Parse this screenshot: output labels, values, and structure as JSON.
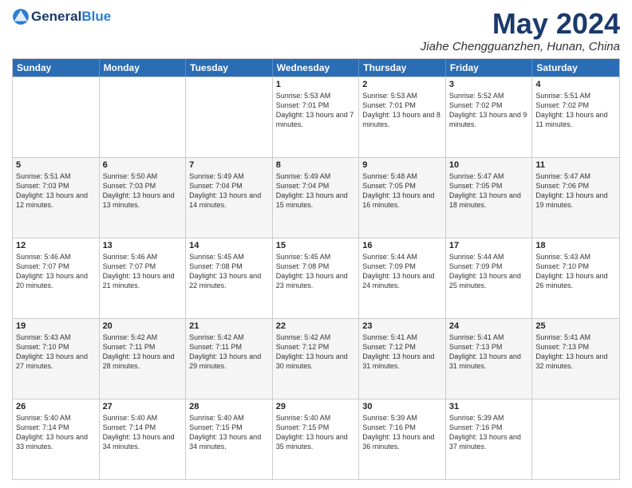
{
  "header": {
    "logo_general": "General",
    "logo_blue": "Blue",
    "month_title": "May 2024",
    "location": "Jiahe Chengguanzhen, Hunan, China"
  },
  "weekdays": [
    "Sunday",
    "Monday",
    "Tuesday",
    "Wednesday",
    "Thursday",
    "Friday",
    "Saturday"
  ],
  "rows": [
    [
      {
        "day": "",
        "sunrise": "",
        "sunset": "",
        "daylight": ""
      },
      {
        "day": "",
        "sunrise": "",
        "sunset": "",
        "daylight": ""
      },
      {
        "day": "",
        "sunrise": "",
        "sunset": "",
        "daylight": ""
      },
      {
        "day": "1",
        "sunrise": "Sunrise: 5:53 AM",
        "sunset": "Sunset: 7:01 PM",
        "daylight": "Daylight: 13 hours and 7 minutes."
      },
      {
        "day": "2",
        "sunrise": "Sunrise: 5:53 AM",
        "sunset": "Sunset: 7:01 PM",
        "daylight": "Daylight: 13 hours and 8 minutes."
      },
      {
        "day": "3",
        "sunrise": "Sunrise: 5:52 AM",
        "sunset": "Sunset: 7:02 PM",
        "daylight": "Daylight: 13 hours and 9 minutes."
      },
      {
        "day": "4",
        "sunrise": "Sunrise: 5:51 AM",
        "sunset": "Sunset: 7:02 PM",
        "daylight": "Daylight: 13 hours and 11 minutes."
      }
    ],
    [
      {
        "day": "5",
        "sunrise": "Sunrise: 5:51 AM",
        "sunset": "Sunset: 7:03 PM",
        "daylight": "Daylight: 13 hours and 12 minutes."
      },
      {
        "day": "6",
        "sunrise": "Sunrise: 5:50 AM",
        "sunset": "Sunset: 7:03 PM",
        "daylight": "Daylight: 13 hours and 13 minutes."
      },
      {
        "day": "7",
        "sunrise": "Sunrise: 5:49 AM",
        "sunset": "Sunset: 7:04 PM",
        "daylight": "Daylight: 13 hours and 14 minutes."
      },
      {
        "day": "8",
        "sunrise": "Sunrise: 5:49 AM",
        "sunset": "Sunset: 7:04 PM",
        "daylight": "Daylight: 13 hours and 15 minutes."
      },
      {
        "day": "9",
        "sunrise": "Sunrise: 5:48 AM",
        "sunset": "Sunset: 7:05 PM",
        "daylight": "Daylight: 13 hours and 16 minutes."
      },
      {
        "day": "10",
        "sunrise": "Sunrise: 5:47 AM",
        "sunset": "Sunset: 7:05 PM",
        "daylight": "Daylight: 13 hours and 18 minutes."
      },
      {
        "day": "11",
        "sunrise": "Sunrise: 5:47 AM",
        "sunset": "Sunset: 7:06 PM",
        "daylight": "Daylight: 13 hours and 19 minutes."
      }
    ],
    [
      {
        "day": "12",
        "sunrise": "Sunrise: 5:46 AM",
        "sunset": "Sunset: 7:07 PM",
        "daylight": "Daylight: 13 hours and 20 minutes."
      },
      {
        "day": "13",
        "sunrise": "Sunrise: 5:46 AM",
        "sunset": "Sunset: 7:07 PM",
        "daylight": "Daylight: 13 hours and 21 minutes."
      },
      {
        "day": "14",
        "sunrise": "Sunrise: 5:45 AM",
        "sunset": "Sunset: 7:08 PM",
        "daylight": "Daylight: 13 hours and 22 minutes."
      },
      {
        "day": "15",
        "sunrise": "Sunrise: 5:45 AM",
        "sunset": "Sunset: 7:08 PM",
        "daylight": "Daylight: 13 hours and 23 minutes."
      },
      {
        "day": "16",
        "sunrise": "Sunrise: 5:44 AM",
        "sunset": "Sunset: 7:09 PM",
        "daylight": "Daylight: 13 hours and 24 minutes."
      },
      {
        "day": "17",
        "sunrise": "Sunrise: 5:44 AM",
        "sunset": "Sunset: 7:09 PM",
        "daylight": "Daylight: 13 hours and 25 minutes."
      },
      {
        "day": "18",
        "sunrise": "Sunrise: 5:43 AM",
        "sunset": "Sunset: 7:10 PM",
        "daylight": "Daylight: 13 hours and 26 minutes."
      }
    ],
    [
      {
        "day": "19",
        "sunrise": "Sunrise: 5:43 AM",
        "sunset": "Sunset: 7:10 PM",
        "daylight": "Daylight: 13 hours and 27 minutes."
      },
      {
        "day": "20",
        "sunrise": "Sunrise: 5:42 AM",
        "sunset": "Sunset: 7:11 PM",
        "daylight": "Daylight: 13 hours and 28 minutes."
      },
      {
        "day": "21",
        "sunrise": "Sunrise: 5:42 AM",
        "sunset": "Sunset: 7:11 PM",
        "daylight": "Daylight: 13 hours and 29 minutes."
      },
      {
        "day": "22",
        "sunrise": "Sunrise: 5:42 AM",
        "sunset": "Sunset: 7:12 PM",
        "daylight": "Daylight: 13 hours and 30 minutes."
      },
      {
        "day": "23",
        "sunrise": "Sunrise: 5:41 AM",
        "sunset": "Sunset: 7:12 PM",
        "daylight": "Daylight: 13 hours and 31 minutes."
      },
      {
        "day": "24",
        "sunrise": "Sunrise: 5:41 AM",
        "sunset": "Sunset: 7:13 PM",
        "daylight": "Daylight: 13 hours and 31 minutes."
      },
      {
        "day": "25",
        "sunrise": "Sunrise: 5:41 AM",
        "sunset": "Sunset: 7:13 PM",
        "daylight": "Daylight: 13 hours and 32 minutes."
      }
    ],
    [
      {
        "day": "26",
        "sunrise": "Sunrise: 5:40 AM",
        "sunset": "Sunset: 7:14 PM",
        "daylight": "Daylight: 13 hours and 33 minutes."
      },
      {
        "day": "27",
        "sunrise": "Sunrise: 5:40 AM",
        "sunset": "Sunset: 7:14 PM",
        "daylight": "Daylight: 13 hours and 34 minutes."
      },
      {
        "day": "28",
        "sunrise": "Sunrise: 5:40 AM",
        "sunset": "Sunset: 7:15 PM",
        "daylight": "Daylight: 13 hours and 34 minutes."
      },
      {
        "day": "29",
        "sunrise": "Sunrise: 5:40 AM",
        "sunset": "Sunset: 7:15 PM",
        "daylight": "Daylight: 13 hours and 35 minutes."
      },
      {
        "day": "30",
        "sunrise": "Sunrise: 5:39 AM",
        "sunset": "Sunset: 7:16 PM",
        "daylight": "Daylight: 13 hours and 36 minutes."
      },
      {
        "day": "31",
        "sunrise": "Sunrise: 5:39 AM",
        "sunset": "Sunset: 7:16 PM",
        "daylight": "Daylight: 13 hours and 37 minutes."
      },
      {
        "day": "",
        "sunrise": "",
        "sunset": "",
        "daylight": ""
      }
    ]
  ]
}
